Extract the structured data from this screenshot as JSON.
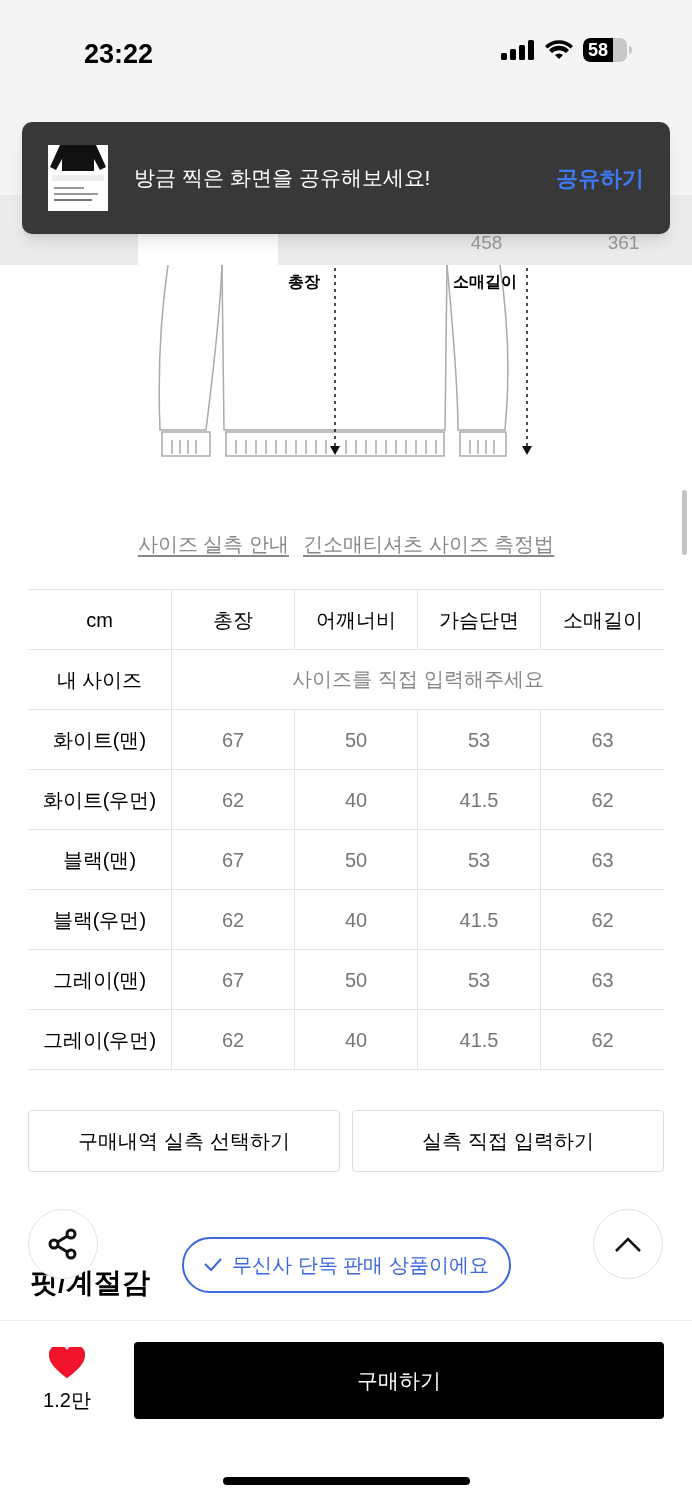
{
  "status_bar": {
    "time": "23:22",
    "battery": "58"
  },
  "toast": {
    "message": "방금 찍은 화면을 공유해보세요!",
    "action": "공유하기"
  },
  "tabs": [
    {
      "selected": true
    },
    {
      "count": "458",
      "selected": false
    },
    {
      "count": "361",
      "selected": false
    }
  ],
  "diagram": {
    "labels": [
      "총장",
      "소매길이"
    ]
  },
  "links": [
    "사이즈 실측 안내",
    "긴소매티셔츠 사이즈 측정법"
  ],
  "size_table": {
    "columns": [
      "cm",
      "총장",
      "어깨너비",
      "가슴단면",
      "소매길이"
    ],
    "my_size": {
      "label": "내 사이즈",
      "placeholder": "사이즈를 직접 입력해주세요"
    },
    "rows": [
      [
        "화이트(맨)",
        "67",
        "50",
        "53",
        "63"
      ],
      [
        "화이트(우먼)",
        "62",
        "40",
        "41.5",
        "62"
      ],
      [
        "블랙(맨)",
        "67",
        "50",
        "53",
        "63"
      ],
      [
        "블랙(우먼)",
        "62",
        "40",
        "41.5",
        "62"
      ],
      [
        "그레이(맨)",
        "67",
        "50",
        "53",
        "63"
      ],
      [
        "그레이(우먼)",
        "62",
        "40",
        "41.5",
        "62"
      ]
    ]
  },
  "actions": [
    "구매내역 실측 선택하기",
    "실측 직접 입력하기"
  ],
  "section_title": "핏/계절감",
  "exclusive_badge": "무신사 단독 판매 상품이에요",
  "bottom_bar": {
    "liked": true,
    "like_count": "1.2만",
    "buy": "구매하기"
  }
}
